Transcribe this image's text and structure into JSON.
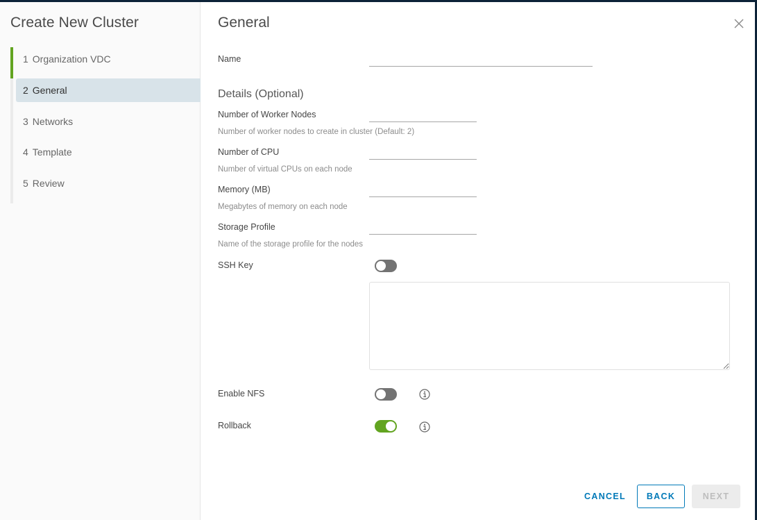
{
  "wizard": {
    "title": "Create New Cluster",
    "steps": [
      {
        "num": "1",
        "label": "Organization VDC",
        "state": "completed"
      },
      {
        "num": "2",
        "label": "General",
        "state": "active"
      },
      {
        "num": "3",
        "label": "Networks",
        "state": "pending"
      },
      {
        "num": "4",
        "label": "Template",
        "state": "pending"
      },
      {
        "num": "5",
        "label": "Review",
        "state": "pending"
      }
    ]
  },
  "page": {
    "title": "General",
    "close_icon": "close-icon",
    "name": {
      "label": "Name",
      "value": "",
      "placeholder": ""
    },
    "details_heading": "Details (Optional)",
    "fields": [
      {
        "label": "Number of Worker Nodes",
        "helper": "Number of worker nodes to create in cluster (Default: 2)",
        "value": ""
      },
      {
        "label": "Number of CPU",
        "helper": "Number of virtual CPUs on each node",
        "value": ""
      },
      {
        "label": "Memory (MB)",
        "helper": "Megabytes of memory on each node",
        "value": ""
      },
      {
        "label": "Storage Profile",
        "helper": "Name of the storage profile for the nodes",
        "value": ""
      }
    ],
    "ssh_key": {
      "label": "SSH Key",
      "enabled": false,
      "value": ""
    },
    "enable_nfs": {
      "label": "Enable NFS",
      "enabled": false,
      "info_icon": "info-icon"
    },
    "rollback": {
      "label": "Rollback",
      "enabled": true,
      "info_icon": "info-icon"
    }
  },
  "footer": {
    "cancel": "CANCEL",
    "back": "BACK",
    "next": "NEXT"
  },
  "colors": {
    "accent": "#0079b8",
    "success": "#62a420",
    "active_step_bg": "#d8e3e9"
  }
}
